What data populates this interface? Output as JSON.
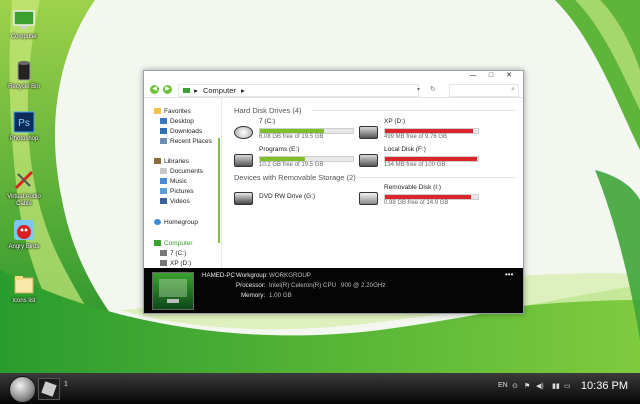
{
  "desktop": {
    "icons": [
      {
        "label": "Computer",
        "icon": "computer-icon"
      },
      {
        "label": "Recycle Bin",
        "icon": "recycle-bin-icon"
      },
      {
        "label": "Photoshop",
        "icon": "photoshop-icon",
        "glyph": "Ps"
      },
      {
        "label": "Virtual Audio Cable",
        "icon": "audio-app-icon"
      },
      {
        "label": "Angry Birds",
        "icon": "angry-birds-icon"
      },
      {
        "label": "Icons list",
        "icon": "folder-icon"
      }
    ]
  },
  "explorer": {
    "breadcrumb": "Computer",
    "breadcrumb_arrow": "▸",
    "sidebar": {
      "favorites": {
        "header": "Favorites",
        "items": [
          "Desktop",
          "Downloads",
          "Recent Places"
        ]
      },
      "libraries": {
        "header": "Libraries",
        "items": [
          "Documents",
          "Music",
          "Pictures",
          "Videos"
        ]
      },
      "homegroup": "Homegroup",
      "computer": {
        "header": "Computer",
        "items": [
          "7 (C:)",
          "XP (D:)"
        ]
      }
    },
    "sections": {
      "hdd": "Hard Disk Drives (4)",
      "removable": "Devices with Removable Storage (2)"
    },
    "drives": [
      {
        "name": "7 (C:)",
        "free": "6.08 GB free of 19.5 GB",
        "used_fraction": 0.69,
        "bar_color": "#7dbf2a"
      },
      {
        "name": "XP (D:)",
        "free": "499 MB free of 9.76 GB",
        "used_fraction": 0.95,
        "bar_color": "#d8262b"
      },
      {
        "name": "Programs (E:)",
        "free": "10.2 GB free of 19.5 GB",
        "used_fraction": 0.48,
        "bar_color": "#7dbf2a"
      },
      {
        "name": "Local Disk (F:)",
        "free": "134 MB free of 100 GB",
        "used_fraction": 0.99,
        "bar_color": "#d8262b"
      }
    ],
    "removable": [
      {
        "name": "DVD RW Drive (G:)"
      },
      {
        "name": "Removable Disk (I:)",
        "free": "0.98 GB free of 14.9 GB",
        "used_fraction": 0.93,
        "bar_color": "#d8262b"
      }
    ],
    "details": {
      "pc_name": "HAMED-PC",
      "workgroup_label": "Workgroup:",
      "workgroup": "WORKGROUP",
      "processor_label": "Processor:",
      "processor": "Intel(R) Celeron(R) CPU",
      "processor_speed": "900 @ 2.20GHz",
      "memory_label": "Memory:",
      "memory": "1.00 GB",
      "more": "•••"
    }
  },
  "taskbar": {
    "pinned_count": "1",
    "language": "EN",
    "time": "10:36 PM"
  }
}
